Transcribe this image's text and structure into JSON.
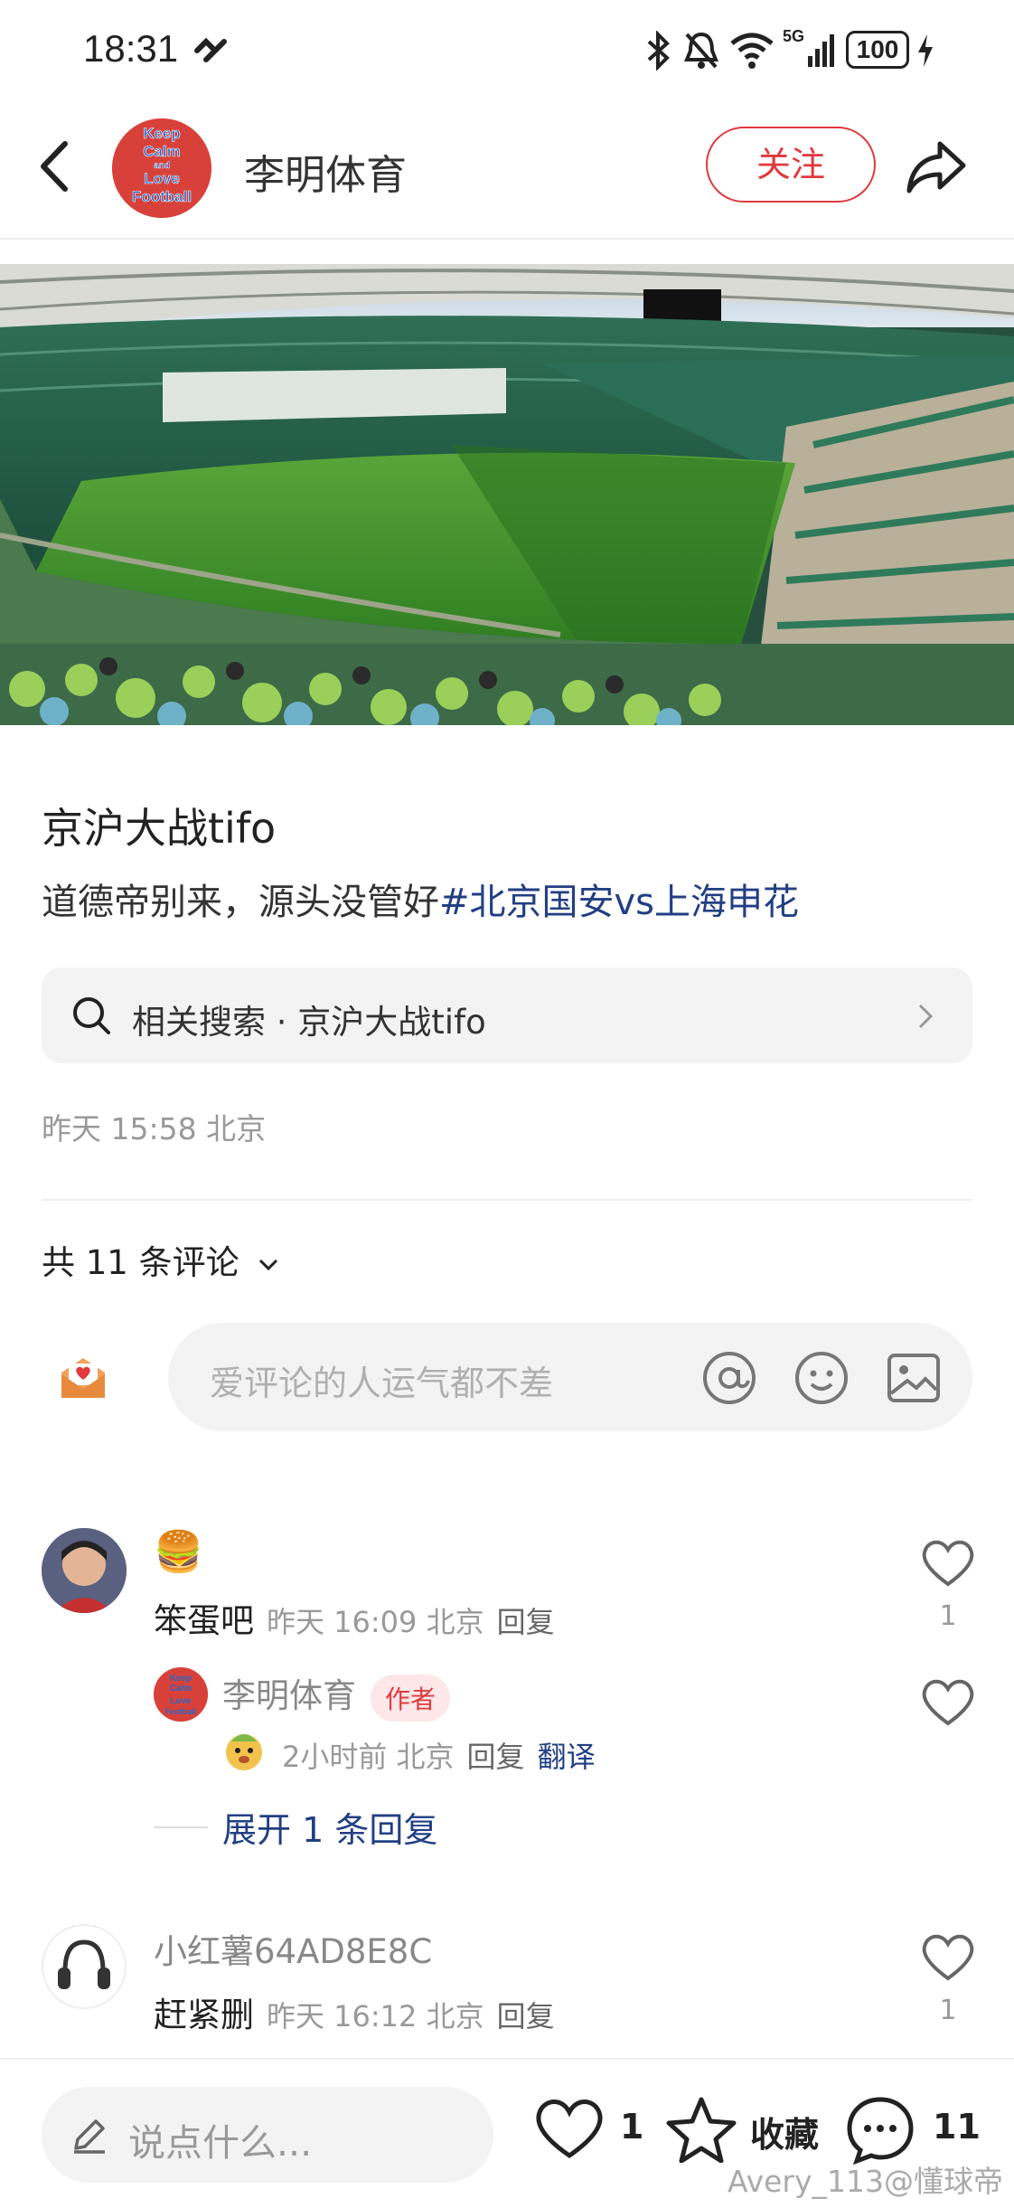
{
  "status_bar": {
    "time": "18:31",
    "battery": "100",
    "network": "5G"
  },
  "header": {
    "author_name": "李明体育",
    "follow_label": "关注",
    "avatar_text": [
      "Keep",
      "Calm",
      "and",
      "Love",
      "Football"
    ]
  },
  "post": {
    "title": "京沪大战tifo",
    "desc_text": "道德帝别来，源头没管好",
    "desc_tag": "#北京国安vs上海申花",
    "related_search": "相关搜索 · 京沪大战tifo",
    "meta": "昨天 15:58 北京"
  },
  "comments_section": {
    "count_label": "共 11 条评论",
    "input_placeholder": "爱评论的人运气都不差"
  },
  "comments": [
    {
      "emoji": "🍔",
      "name": "笨蛋吧",
      "meta": "昨天 16:09 北京",
      "reply": "回复",
      "likes": "1"
    },
    {
      "name": "小红薯64AD8E8C",
      "text": "赶紧删",
      "meta": "昨天 16:12 北京",
      "reply": "回复",
      "likes": "1"
    }
  ],
  "reply": {
    "name": "李明体育",
    "badge": "作者",
    "meta": "2小时前 北京",
    "reply": "回复",
    "translate": "翻译",
    "expand": "展开 1 条回复"
  },
  "bottom_bar": {
    "say_placeholder": "说点什么...",
    "like_count": "1",
    "collect_label": "收藏",
    "comment_count": "11"
  },
  "watermark": "Avery_113@懂球帝",
  "colors": {
    "accent_red": "#e0393e",
    "link_blue": "#223f84"
  }
}
